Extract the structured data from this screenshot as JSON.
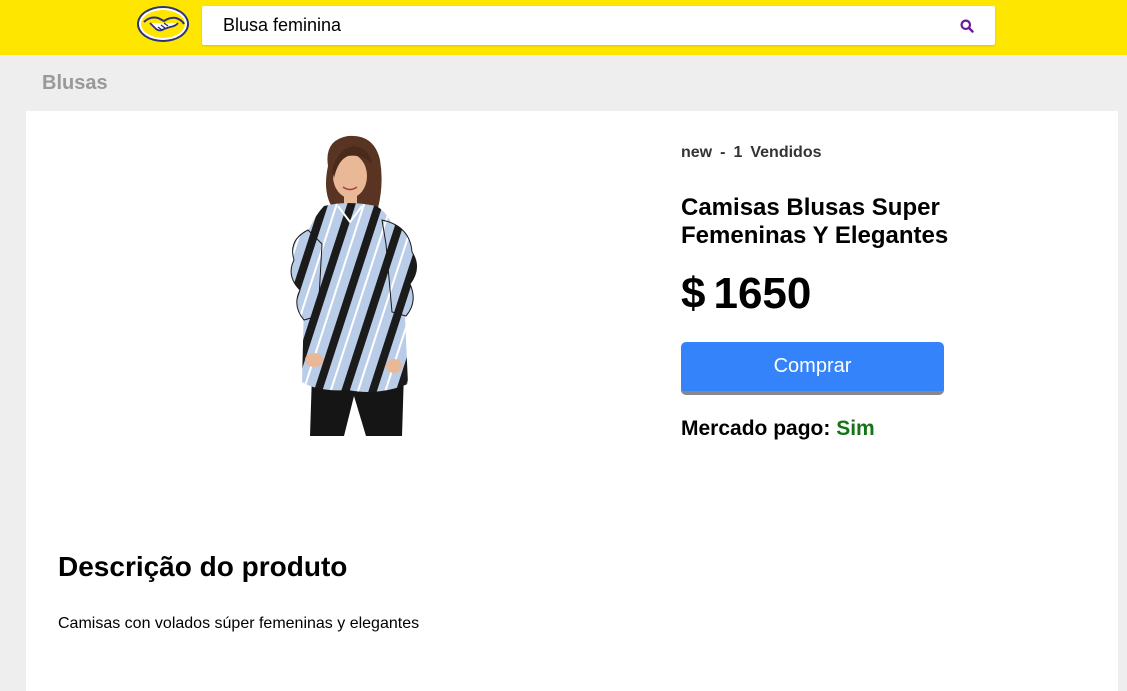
{
  "header": {
    "logo_icon": "mercadolibre-handshake-logo",
    "search": {
      "value": "Blusa feminina",
      "icon": "search-icon"
    },
    "colors": {
      "background": "#ffe600",
      "search_icon": "#6a1b9a"
    }
  },
  "breadcrumb": "Blusas",
  "product": {
    "condition": "new",
    "separator": "-",
    "sold_count": "1",
    "sold_label": "Vendidos",
    "title": "Camisas Blusas Super Femeninas Y Elegantes",
    "currency": "$",
    "price": "1650",
    "buy_label": "Comprar",
    "mercado_pago_label": "Mercado pago:",
    "mercado_pago_value": "Sim",
    "image": "striped-blouse-photo",
    "colors": {
      "buy_button": "#3483fa",
      "mercado_pago_value": "#177317"
    }
  },
  "description": {
    "title": "Descrição do produto",
    "text": "Camisas con volados súper femeninas y elegantes"
  }
}
